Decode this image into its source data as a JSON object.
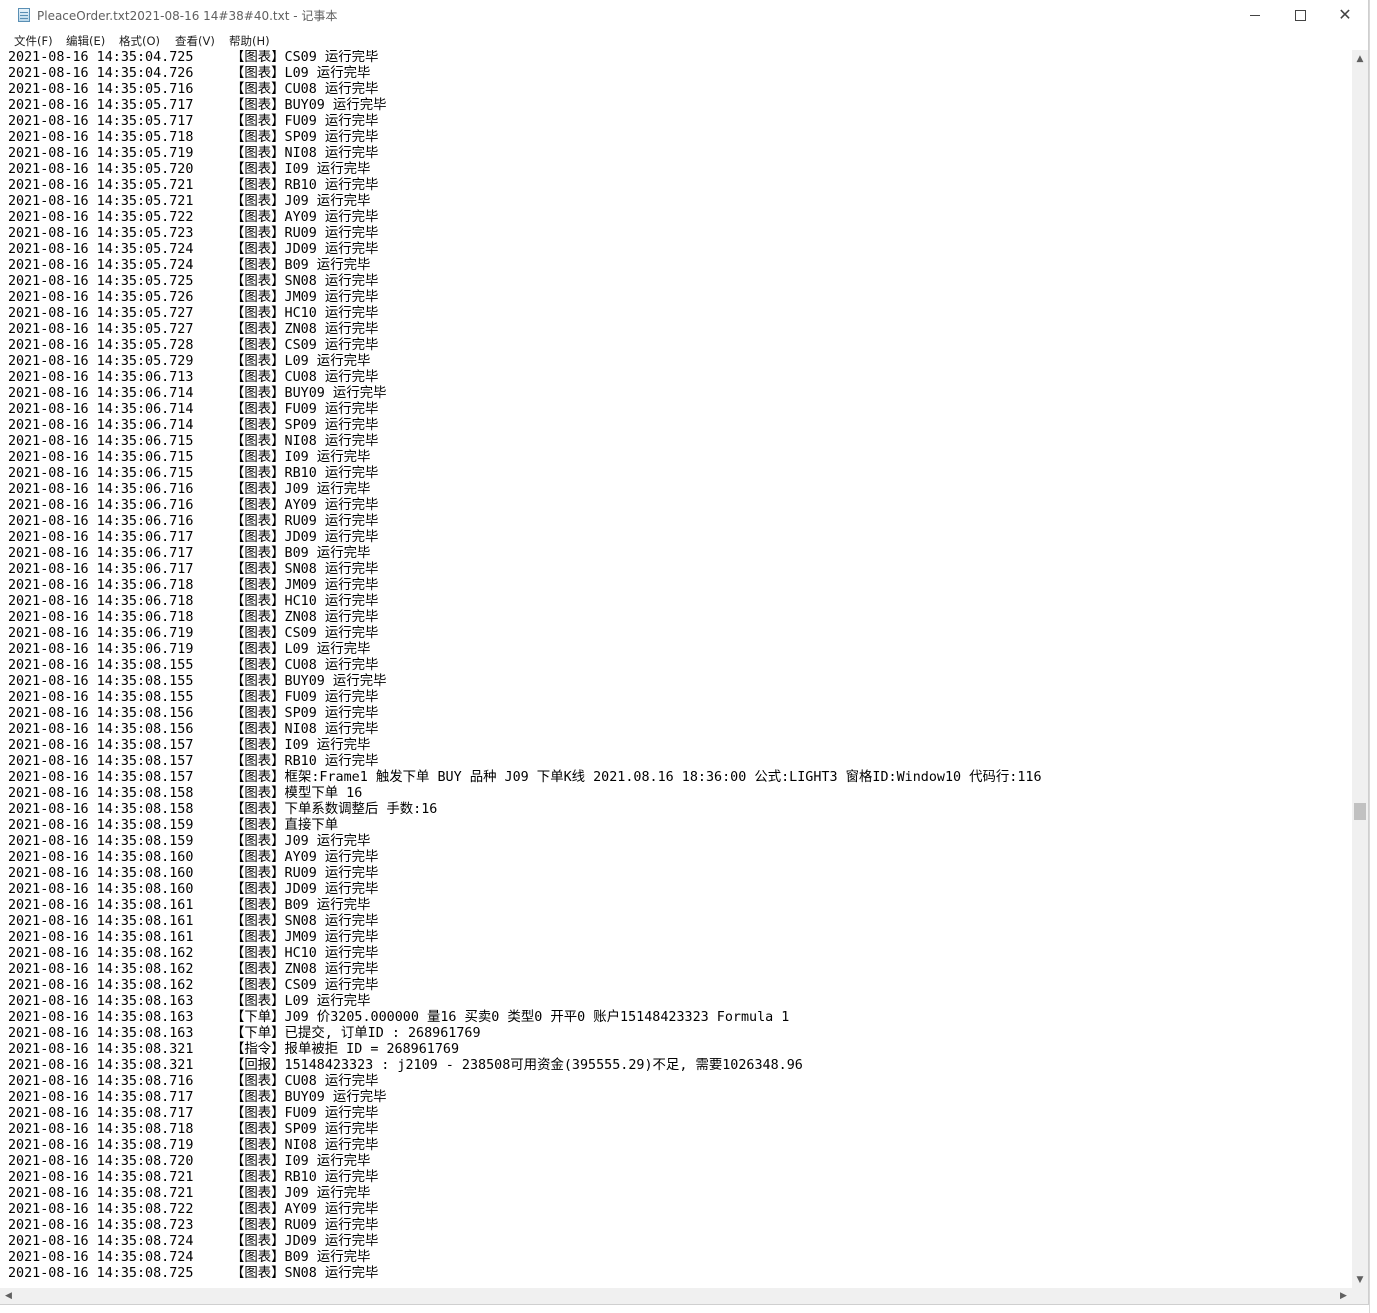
{
  "window": {
    "title": "PleaceOrder.txt2021-08-16 14#38#40.txt - 记事本",
    "minimize_glyph": "",
    "close_glyph": "✕"
  },
  "menu": {
    "file": "文件(F)",
    "edit": "编辑(E)",
    "format": "格式(O)",
    "view": "查看(V)",
    "help": "帮助(H)"
  },
  "scrollbar": {
    "vertical_position": 0.62,
    "up_arrow": "▲",
    "down_arrow": "▼",
    "left_arrow": "◀",
    "right_arrow": "▶"
  },
  "log": [
    {
      "ts": "2021-08-16 14:35:04.725",
      "msg": "【图表】CS09 运行完毕"
    },
    {
      "ts": "2021-08-16 14:35:04.726",
      "msg": "【图表】L09 运行完毕"
    },
    {
      "ts": "2021-08-16 14:35:05.716",
      "msg": "【图表】CU08 运行完毕"
    },
    {
      "ts": "2021-08-16 14:35:05.717",
      "msg": "【图表】BUY09 运行完毕"
    },
    {
      "ts": "2021-08-16 14:35:05.717",
      "msg": "【图表】FU09 运行完毕"
    },
    {
      "ts": "2021-08-16 14:35:05.718",
      "msg": "【图表】SP09 运行完毕"
    },
    {
      "ts": "2021-08-16 14:35:05.719",
      "msg": "【图表】NI08 运行完毕"
    },
    {
      "ts": "2021-08-16 14:35:05.720",
      "msg": "【图表】I09 运行完毕"
    },
    {
      "ts": "2021-08-16 14:35:05.721",
      "msg": "【图表】RB10 运行完毕"
    },
    {
      "ts": "2021-08-16 14:35:05.721",
      "msg": "【图表】J09 运行完毕"
    },
    {
      "ts": "2021-08-16 14:35:05.722",
      "msg": "【图表】AY09 运行完毕"
    },
    {
      "ts": "2021-08-16 14:35:05.723",
      "msg": "【图表】RU09 运行完毕"
    },
    {
      "ts": "2021-08-16 14:35:05.724",
      "msg": "【图表】JD09 运行完毕"
    },
    {
      "ts": "2021-08-16 14:35:05.724",
      "msg": "【图表】B09 运行完毕"
    },
    {
      "ts": "2021-08-16 14:35:05.725",
      "msg": "【图表】SN08 运行完毕"
    },
    {
      "ts": "2021-08-16 14:35:05.726",
      "msg": "【图表】JM09 运行完毕"
    },
    {
      "ts": "2021-08-16 14:35:05.727",
      "msg": "【图表】HC10 运行完毕"
    },
    {
      "ts": "2021-08-16 14:35:05.727",
      "msg": "【图表】ZN08 运行完毕"
    },
    {
      "ts": "2021-08-16 14:35:05.728",
      "msg": "【图表】CS09 运行完毕"
    },
    {
      "ts": "2021-08-16 14:35:05.729",
      "msg": "【图表】L09 运行完毕"
    },
    {
      "ts": "2021-08-16 14:35:06.713",
      "msg": "【图表】CU08 运行完毕"
    },
    {
      "ts": "2021-08-16 14:35:06.714",
      "msg": "【图表】BUY09 运行完毕"
    },
    {
      "ts": "2021-08-16 14:35:06.714",
      "msg": "【图表】FU09 运行完毕"
    },
    {
      "ts": "2021-08-16 14:35:06.714",
      "msg": "【图表】SP09 运行完毕"
    },
    {
      "ts": "2021-08-16 14:35:06.715",
      "msg": "【图表】NI08 运行完毕"
    },
    {
      "ts": "2021-08-16 14:35:06.715",
      "msg": "【图表】I09 运行完毕"
    },
    {
      "ts": "2021-08-16 14:35:06.715",
      "msg": "【图表】RB10 运行完毕"
    },
    {
      "ts": "2021-08-16 14:35:06.716",
      "msg": "【图表】J09 运行完毕"
    },
    {
      "ts": "2021-08-16 14:35:06.716",
      "msg": "【图表】AY09 运行完毕"
    },
    {
      "ts": "2021-08-16 14:35:06.716",
      "msg": "【图表】RU09 运行完毕"
    },
    {
      "ts": "2021-08-16 14:35:06.717",
      "msg": "【图表】JD09 运行完毕"
    },
    {
      "ts": "2021-08-16 14:35:06.717",
      "msg": "【图表】B09 运行完毕"
    },
    {
      "ts": "2021-08-16 14:35:06.717",
      "msg": "【图表】SN08 运行完毕"
    },
    {
      "ts": "2021-08-16 14:35:06.718",
      "msg": "【图表】JM09 运行完毕"
    },
    {
      "ts": "2021-08-16 14:35:06.718",
      "msg": "【图表】HC10 运行完毕"
    },
    {
      "ts": "2021-08-16 14:35:06.718",
      "msg": "【图表】ZN08 运行完毕"
    },
    {
      "ts": "2021-08-16 14:35:06.719",
      "msg": "【图表】CS09 运行完毕"
    },
    {
      "ts": "2021-08-16 14:35:06.719",
      "msg": "【图表】L09 运行完毕"
    },
    {
      "ts": "2021-08-16 14:35:08.155",
      "msg": "【图表】CU08 运行完毕"
    },
    {
      "ts": "2021-08-16 14:35:08.155",
      "msg": "【图表】BUY09 运行完毕"
    },
    {
      "ts": "2021-08-16 14:35:08.155",
      "msg": "【图表】FU09 运行完毕"
    },
    {
      "ts": "2021-08-16 14:35:08.156",
      "msg": "【图表】SP09 运行完毕"
    },
    {
      "ts": "2021-08-16 14:35:08.156",
      "msg": "【图表】NI08 运行完毕"
    },
    {
      "ts": "2021-08-16 14:35:08.157",
      "msg": "【图表】I09 运行完毕"
    },
    {
      "ts": "2021-08-16 14:35:08.157",
      "msg": "【图表】RB10 运行完毕"
    },
    {
      "ts": "2021-08-16 14:35:08.157",
      "msg": "【图表】框架:Frame1 触发下单 BUY 品种 J09 下单K线 2021.08.16 18:36:00 公式:LIGHT3 窗格ID:Window10 代码行:116"
    },
    {
      "ts": "2021-08-16 14:35:08.158",
      "msg": "【图表】模型下单 16"
    },
    {
      "ts": "2021-08-16 14:35:08.158",
      "msg": "【图表】下单系数调整后 手数:16"
    },
    {
      "ts": "2021-08-16 14:35:08.159",
      "msg": "【图表】直接下单"
    },
    {
      "ts": "2021-08-16 14:35:08.159",
      "msg": "【图表】J09 运行完毕"
    },
    {
      "ts": "2021-08-16 14:35:08.160",
      "msg": "【图表】AY09 运行完毕"
    },
    {
      "ts": "2021-08-16 14:35:08.160",
      "msg": "【图表】RU09 运行完毕"
    },
    {
      "ts": "2021-08-16 14:35:08.160",
      "msg": "【图表】JD09 运行完毕"
    },
    {
      "ts": "2021-08-16 14:35:08.161",
      "msg": "【图表】B09 运行完毕"
    },
    {
      "ts": "2021-08-16 14:35:08.161",
      "msg": "【图表】SN08 运行完毕"
    },
    {
      "ts": "2021-08-16 14:35:08.161",
      "msg": "【图表】JM09 运行完毕"
    },
    {
      "ts": "2021-08-16 14:35:08.162",
      "msg": "【图表】HC10 运行完毕"
    },
    {
      "ts": "2021-08-16 14:35:08.162",
      "msg": "【图表】ZN08 运行完毕"
    },
    {
      "ts": "2021-08-16 14:35:08.162",
      "msg": "【图表】CS09 运行完毕"
    },
    {
      "ts": "2021-08-16 14:35:08.163",
      "msg": "【图表】L09 运行完毕"
    },
    {
      "ts": "2021-08-16 14:35:08.163",
      "msg": "【下单】J09 价3205.000000 量16 买卖0 类型0 开平0 账户15148423323 Formula 1"
    },
    {
      "ts": "2021-08-16 14:35:08.163",
      "msg": "【下单】已提交, 订单ID : 268961769"
    },
    {
      "ts": "2021-08-16 14:35:08.321",
      "msg": "【指令】报单被拒 ID = 268961769"
    },
    {
      "ts": "2021-08-16 14:35:08.321",
      "msg": "【回报】15148423323 : j2109 - 238508可用资金(395555.29)不足, 需要1026348.96"
    },
    {
      "ts": "2021-08-16 14:35:08.716",
      "msg": "【图表】CU08 运行完毕"
    },
    {
      "ts": "2021-08-16 14:35:08.717",
      "msg": "【图表】BUY09 运行完毕"
    },
    {
      "ts": "2021-08-16 14:35:08.717",
      "msg": "【图表】FU09 运行完毕"
    },
    {
      "ts": "2021-08-16 14:35:08.718",
      "msg": "【图表】SP09 运行完毕"
    },
    {
      "ts": "2021-08-16 14:35:08.719",
      "msg": "【图表】NI08 运行完毕"
    },
    {
      "ts": "2021-08-16 14:35:08.720",
      "msg": "【图表】I09 运行完毕"
    },
    {
      "ts": "2021-08-16 14:35:08.721",
      "msg": "【图表】RB10 运行完毕"
    },
    {
      "ts": "2021-08-16 14:35:08.721",
      "msg": "【图表】J09 运行完毕"
    },
    {
      "ts": "2021-08-16 14:35:08.722",
      "msg": "【图表】AY09 运行完毕"
    },
    {
      "ts": "2021-08-16 14:35:08.723",
      "msg": "【图表】RU09 运行完毕"
    },
    {
      "ts": "2021-08-16 14:35:08.724",
      "msg": "【图表】JD09 运行完毕"
    },
    {
      "ts": "2021-08-16 14:35:08.724",
      "msg": "【图表】B09 运行完毕"
    },
    {
      "ts": "2021-08-16 14:35:08.725",
      "msg": "【图表】SN08 运行完毕"
    }
  ]
}
